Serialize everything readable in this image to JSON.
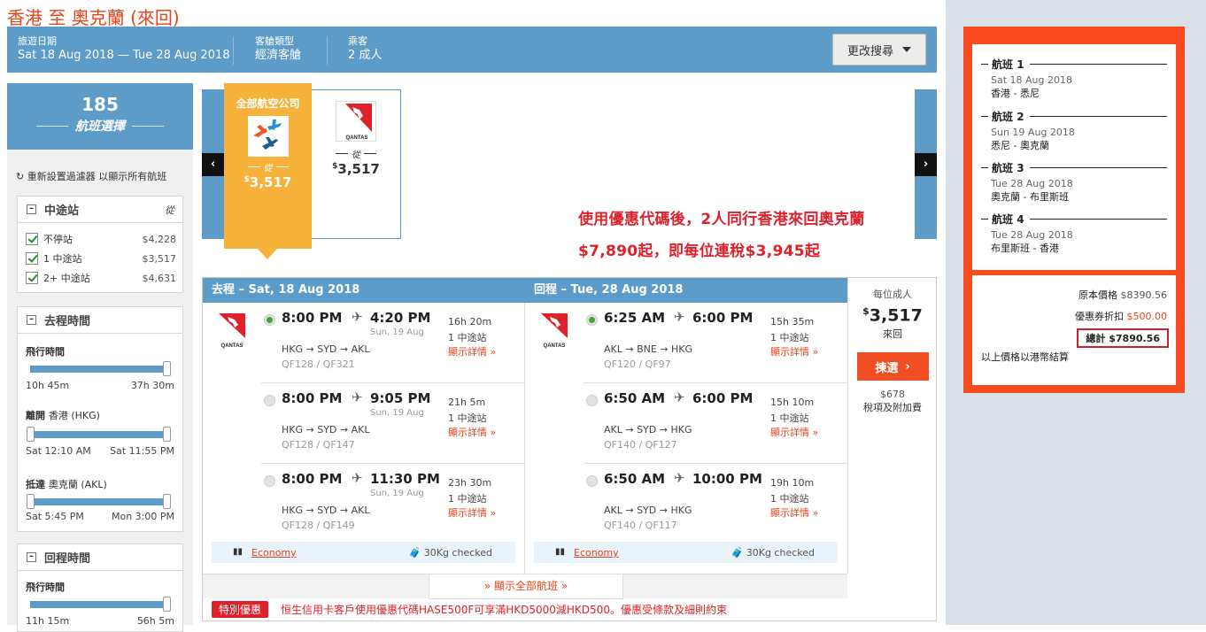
{
  "page_title": "香港 至 奧克蘭 (來回)",
  "search": {
    "date_label": "旅遊日期",
    "date_value": "Sat 18 Aug 2018 — Tue 28 Aug 2018",
    "cabin_label": "客艙類型",
    "cabin_value": "經濟客艙",
    "pax_label": "乘客",
    "pax_value": "2 成人",
    "modify_button": "更改搜尋"
  },
  "sidebar": {
    "count": "185",
    "count_label": "航班選擇",
    "reset_text": "重新設置過濾器 以顯示所有航班",
    "stops_panel": {
      "title": "中途站",
      "from_label": "從",
      "rows": [
        {
          "label": "不停站",
          "price": "$4,228",
          "checked": true
        },
        {
          "label": "1 中途站",
          "price": "$3,517",
          "checked": true
        },
        {
          "label": "2+ 中途站",
          "price": "$4,631",
          "checked": true
        }
      ]
    },
    "outbound_panel": {
      "title": "去程時間",
      "duration_label": "飛行時間",
      "duration_min": "10h 45m",
      "duration_max": "37h 30m",
      "depart_label": "離開",
      "depart_city": "香港 (HKG)",
      "depart_min": "Sat 12:10 AM",
      "depart_max": "Sat 11:55 PM",
      "arrive_label": "抵達",
      "arrive_city": "奧克蘭 (AKL)",
      "arrive_min": "Sat 5:45 PM",
      "arrive_max": "Mon 3:00 PM"
    },
    "return_panel": {
      "title": "回程時間",
      "duration_label": "飛行時間",
      "duration_min": "11h 15m",
      "duration_max": "56h 5m"
    }
  },
  "carousel": {
    "all_airlines_label": "全部航空公司",
    "from_label": "從",
    "all_price": "3,517",
    "qantas_price": "3,517",
    "qantas_logo_text": "QANTAS",
    "currency": "$",
    "prev_icon": "‹",
    "next_icon": "›"
  },
  "promo": {
    "line1": "使用優惠代碼後，2人同行香港來回奧克蘭",
    "line2": "$7,890起，即每位連稅$3,945起"
  },
  "results": {
    "outbound_header": "去程 – Sat, 18 Aug 2018",
    "return_header": "回程 – Tue, 28 Aug 2018",
    "details_label": "顯示詳情 »",
    "outbound": [
      {
        "dep": "8:00 PM",
        "arr": "4:20 PM",
        "arr_date": "Sun, 19 Aug",
        "route": "HKG → SYD → AKL",
        "flights": "QF128 / QF321",
        "duration": "16h 20m",
        "stops": "1 中途站",
        "selected": true
      },
      {
        "dep": "8:00 PM",
        "arr": "9:05 PM",
        "arr_date": "Sun, 19 Aug",
        "route": "HKG → SYD → AKL",
        "flights": "QF128 / QF147",
        "duration": "21h 5m",
        "stops": "1 中途站",
        "selected": false
      },
      {
        "dep": "8:00 PM",
        "arr": "11:30 PM",
        "arr_date": "Sun, 19 Aug",
        "route": "HKG → SYD → AKL",
        "flights": "QF128 / QF149",
        "duration": "23h 30m",
        "stops": "1 中途站",
        "selected": false
      }
    ],
    "return": [
      {
        "dep": "6:25 AM",
        "arr": "6:00 PM",
        "arr_date": "",
        "route": "AKL → BNE → HKG",
        "flights": "QF120 / QF97",
        "duration": "15h 35m",
        "stops": "1 中途站",
        "selected": true
      },
      {
        "dep": "6:50 AM",
        "arr": "6:00 PM",
        "arr_date": "",
        "route": "AKL → SYD → HKG",
        "flights": "QF140 / QF127",
        "duration": "15h 10m",
        "stops": "1 中途站",
        "selected": false
      },
      {
        "dep": "6:50 AM",
        "arr": "10:00 PM",
        "arr_date": "",
        "route": "AKL → SYD → HKG",
        "flights": "QF140 / QF117",
        "duration": "19h 10m",
        "stops": "1 中途站",
        "selected": false
      }
    ],
    "fare_class": "Economy",
    "baggage": "30Kg checked",
    "price_per_adult_label": "每位成人",
    "price": "3,517",
    "round_trip_label": "來回",
    "select_button": "揀選",
    "tax_amount": "$678",
    "tax_label": "稅項及附加費",
    "show_all": "顯示全部航班",
    "special_tag": "特別優惠",
    "special_text": "恒生信用卡客戶使用優惠代碼HASE500F可享滿HKD5000減HKD500。優惠受條款及細則約束"
  },
  "summary": {
    "segments": [
      {
        "label": "航班",
        "num": "1",
        "date": "Sat 18 Aug 2018",
        "route": "香港 - 悉尼"
      },
      {
        "label": "航班",
        "num": "2",
        "date": "Sun 19 Aug 2018",
        "route": "悉尼 - 奧克蘭"
      },
      {
        "label": "航班",
        "num": "3",
        "date": "Tue 28 Aug 2018",
        "route": "奧克蘭 - 布里斯班"
      },
      {
        "label": "航班",
        "num": "4",
        "date": "Tue 28 Aug 2018",
        "route": "布里斯班 - 香港"
      }
    ],
    "original_label": "原本價格",
    "original_value": "$8390.56",
    "discount_label": "優惠券折扣",
    "discount_value": "$500.00",
    "total_label": "總計",
    "total_value": "$7890.56",
    "hkd_note": "以上價格以港幣結算"
  },
  "colors": {
    "brand_blue": "#5d9cc9",
    "accent_orange": "#fa4b1e",
    "promo_red": "#e0202b",
    "carousel_yellow": "#f6b23a"
  }
}
